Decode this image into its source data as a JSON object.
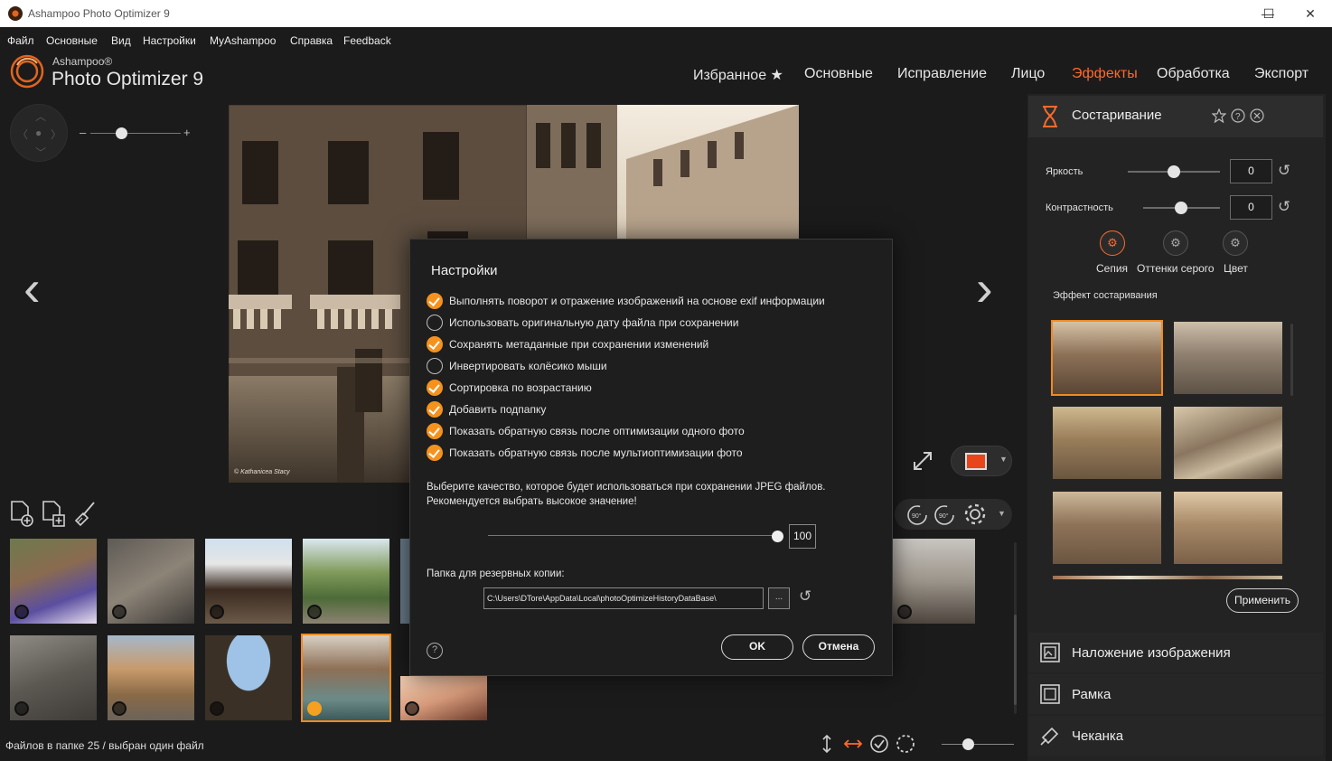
{
  "window": {
    "title": "Ashampoo Photo Optimizer 9",
    "minimize": "—",
    "maximize": "☐",
    "close": "✕"
  },
  "menu": [
    "Файл",
    "Основные",
    "Вид",
    "Настройки",
    "MyAshampoo",
    "Справка",
    "Feedback"
  ],
  "logo": {
    "brand": "Ashampoo®",
    "product": "Photo Optimizer 9"
  },
  "topnav": {
    "items": [
      "Избранное ★",
      "Основные",
      "Исправление",
      "Лицо",
      "Эффекты",
      "Обработка",
      "Экспорт"
    ],
    "active": "Эффекты"
  },
  "viewer": {
    "zoom_minus": "–",
    "zoom_plus": "+",
    "photo_caption": "© Kathanicea Stacy",
    "prev": "‹",
    "next": "›",
    "zoom_level": 0.35
  },
  "colors": {
    "accent": "#f08a22",
    "active_nav": "#ff6a2a"
  },
  "status": {
    "text": "Файлов в папке 25 / выбран один файл"
  },
  "right_panel": {
    "title": "Состаривание",
    "brightness_label": "Яркость",
    "brightness_value": "0",
    "contrast_label": "Контрастность",
    "contrast_value": "0",
    "modes": [
      "Сепия",
      "Оттенки серого",
      "Цвет"
    ],
    "effect_label": "Эффект состаривания",
    "apply": "Применить",
    "accordion": [
      "Наложение изображения",
      "Рамка",
      "Чеканка"
    ]
  },
  "dialog": {
    "title": "Настройки",
    "options": [
      {
        "label": "Выполнять поворот и отражение изображений на основе exif информации",
        "checked": true
      },
      {
        "label": "Использовать оригинальную дату файла при сохранении",
        "checked": false
      },
      {
        "label": "Сохранять метаданные при сохранении изменений",
        "checked": true
      },
      {
        "label": "Инвертировать колёсико мыши",
        "checked": false
      },
      {
        "label": "Сортировка по возрастанию",
        "checked": true
      },
      {
        "label": "Добавить подпапку",
        "checked": true
      },
      {
        "label": "Показать обратную связь после оптимизации одного фото",
        "checked": true
      },
      {
        "label": "Показать обратную связь после мультиоптимизации фото",
        "checked": true
      }
    ],
    "quality_text_1": "Выберите качество, которое будет использоваться при сохранении JPEG файлов.",
    "quality_text_2": "Рекомендуется выбрать высокое значение!",
    "quality_value": "100",
    "backup_label": "Папка для резервных копии:",
    "backup_path": "C:\\Users\\DTore\\AppData\\Local\\photoOptimizeHistoryDataBase\\",
    "browse": "...",
    "help": "?",
    "ok": "OK",
    "cancel": "Отмена"
  }
}
